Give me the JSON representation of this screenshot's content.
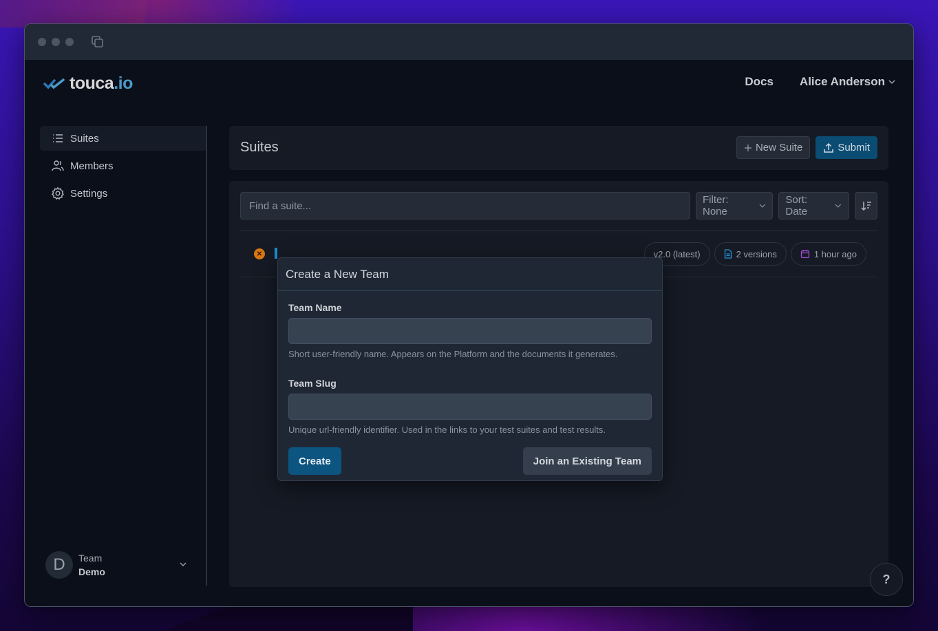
{
  "app": {
    "brand": {
      "name_main": "touca",
      "name_suffix": ".io",
      "accent": "#4a9ac8"
    },
    "nav": {
      "docs_label": "Docs",
      "user_name": "Alice Anderson"
    }
  },
  "sidebar": {
    "items": [
      {
        "label": "Suites",
        "icon": "list-icon",
        "active": true
      },
      {
        "label": "Members",
        "icon": "users-icon",
        "active": false
      },
      {
        "label": "Settings",
        "icon": "gear-icon",
        "active": false
      }
    ],
    "team": {
      "avatar_letter": "D",
      "label": "Team",
      "name": "Demo"
    }
  },
  "main": {
    "title": "Suites",
    "new_suite_label": "New Suite",
    "submit_label": "Submit",
    "search": {
      "placeholder": "Find a suite...",
      "value": ""
    },
    "filter_label": "Filter: None",
    "sort_label": "Sort: Date",
    "suites": [
      {
        "status": "failed",
        "status_color": "#d97812",
        "version_badge": "v2.0 (latest)",
        "versions_badge": "2 versions",
        "time_badge": "1 hour ago"
      }
    ]
  },
  "modal": {
    "title": "Create a New Team",
    "fields": [
      {
        "label": "Team Name",
        "value": "",
        "help": "Short user-friendly name. Appears on the Platform and the documents it generates."
      },
      {
        "label": "Team Slug",
        "value": "",
        "help": "Unique url-friendly identifier. Used in the links to your test suites and test results."
      }
    ],
    "create_label": "Create",
    "join_label": "Join an Existing Team"
  },
  "help": {
    "label": "?"
  }
}
